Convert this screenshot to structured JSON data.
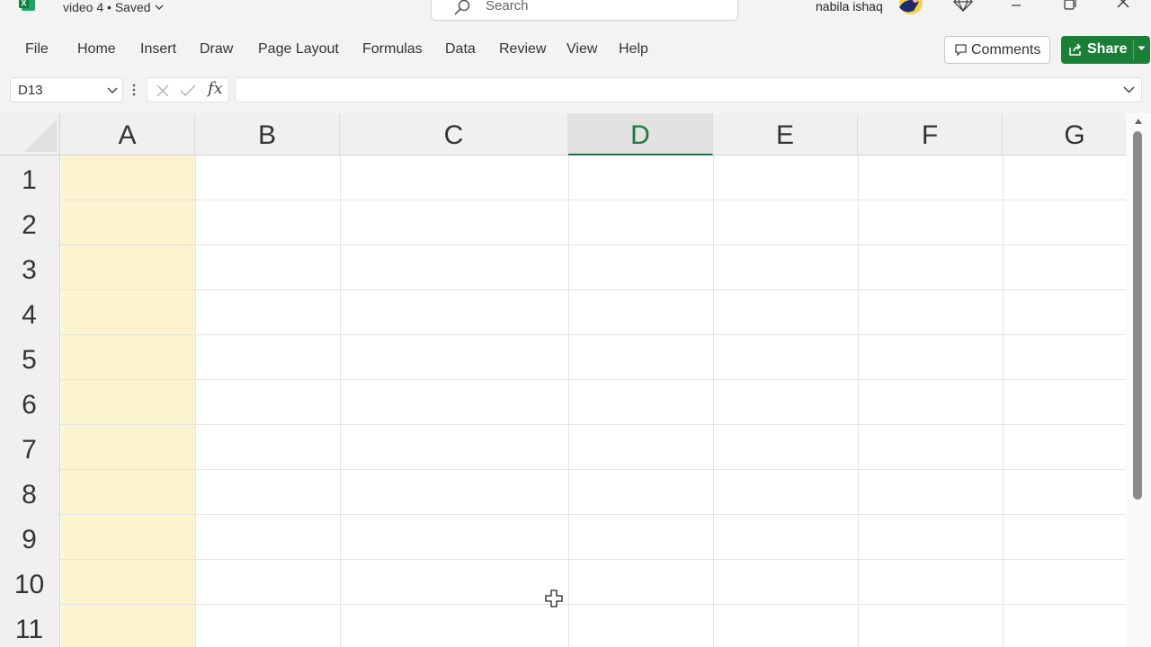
{
  "titlebar": {
    "doc_title": "video 4 • Saved",
    "search_placeholder": "Search",
    "user_name": "nabila ishaq"
  },
  "ribbon": {
    "tabs": [
      "File",
      "Home",
      "Insert",
      "Draw",
      "Page Layout",
      "Formulas",
      "Data",
      "Review",
      "View",
      "Help"
    ],
    "comments_label": "Comments",
    "share_label": "Share"
  },
  "formula_bar": {
    "name_box": "D13",
    "fx_label": "fx",
    "formula": ""
  },
  "grid": {
    "columns": [
      "A",
      "B",
      "C",
      "D",
      "E",
      "F",
      "G"
    ],
    "rows": [
      "1",
      "2",
      "3",
      "4",
      "5",
      "6",
      "7",
      "8",
      "9",
      "10",
      "11"
    ],
    "active_column": "D",
    "highlighted_column": "A"
  },
  "colors": {
    "accent_green": "#217346",
    "share_green": "#1a7f37",
    "column_a_fill": "#fcf3cf",
    "header_bg": "#f0f0f0"
  },
  "icons": {
    "app": "excel-logo-icon",
    "search": "search-icon",
    "premium": "diamond-icon",
    "comments": "comment-icon",
    "share": "share-icon"
  }
}
